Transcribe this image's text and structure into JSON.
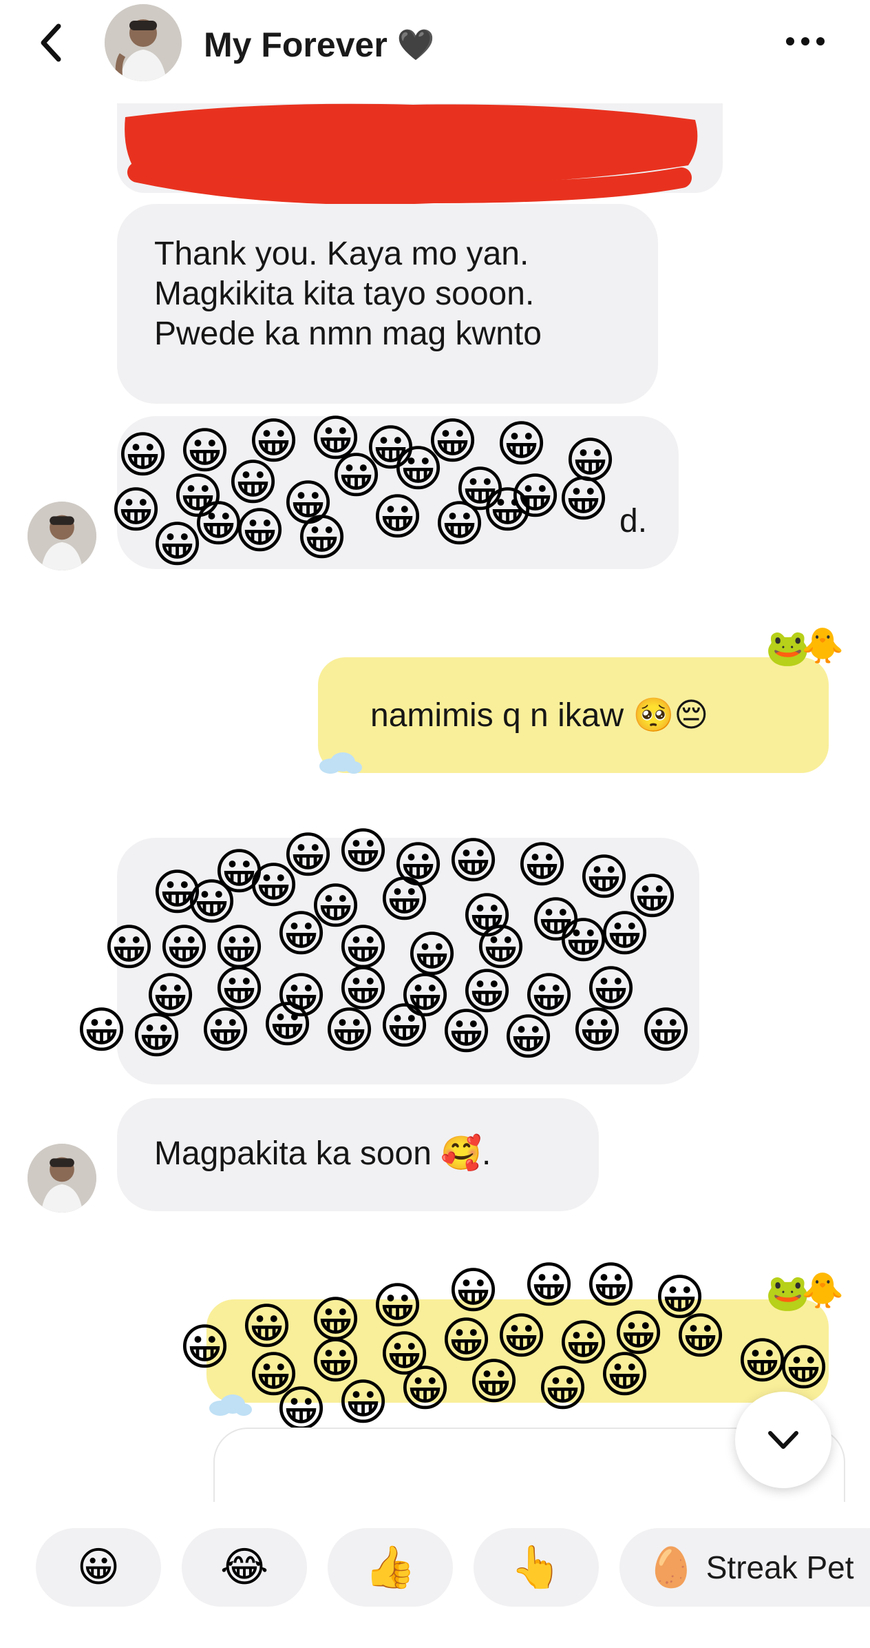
{
  "header": {
    "back_icon": "chevron-left-icon",
    "contact_name": "My Forever",
    "name_emoji": "🖤",
    "more_icon": "more-dots-icon"
  },
  "messages": {
    "m1": {
      "lines": [
        "Thank you. Kaya mo yan.",
        "Magkikita kita tayo sooon.",
        "Pwede ka nmn mag kwnto"
      ]
    },
    "m2": {
      "visible_tail": "d."
    },
    "m3": {
      "text": "namimis q n ikaw 🥺😔"
    },
    "m5": {
      "text": "Magpakita ka soon 🥰."
    }
  },
  "stickers": {
    "frog": "🐸",
    "duck": "🐥"
  },
  "scroll_down_icon": "chevron-down-icon",
  "quick_replies": [
    {
      "emoji": "😀",
      "label": ""
    },
    {
      "emoji": "😂",
      "label": ""
    },
    {
      "emoji": "👍",
      "label": ""
    },
    {
      "emoji": "👆",
      "label": ""
    },
    {
      "emoji": "🥚",
      "label": "Streak Pet"
    }
  ],
  "colors": {
    "incoming_bubble": "#f1f1f3",
    "outgoing_bubble": "#f9ef9a",
    "redaction": "#e8321f"
  }
}
